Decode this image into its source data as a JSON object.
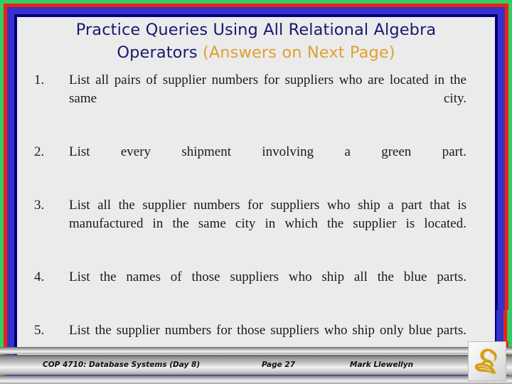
{
  "slide": {
    "background_color": "#ebebeb",
    "frame_colors": {
      "outer_green": "#33cc66",
      "red": "#ee2211",
      "blue": "#3333cc",
      "navy": "#000080"
    }
  },
  "title": {
    "line1": "Practice Queries Using All Relational Algebra",
    "line2_main": "Operators ",
    "line2_accent": "(Answers on Next Page)",
    "color": "#191970",
    "accent_color": "#e0a030"
  },
  "queries": [
    {
      "number": "1.",
      "text": "List all pairs of supplier numbers for suppliers who are located in the same city."
    },
    {
      "number": "2.",
      "text": "List every shipment involving a green part."
    },
    {
      "number": "3.",
      "text": "List all the supplier numbers for suppliers who ship a part that is manufactured in the same city in which the supplier is located."
    },
    {
      "number": "4.",
      "text": "List the names of those suppliers who ship all the blue parts."
    },
    {
      "number": "5.",
      "text": "List the supplier numbers for those suppliers who ship only blue parts."
    }
  ],
  "footer": {
    "course": "COP 4710: Database Systems  (Day 8)",
    "page": "Page 27",
    "author": "Mark Llewellyn",
    "logo_name": "ucf-pegasus-logo",
    "logo_color": "#d4a017"
  }
}
